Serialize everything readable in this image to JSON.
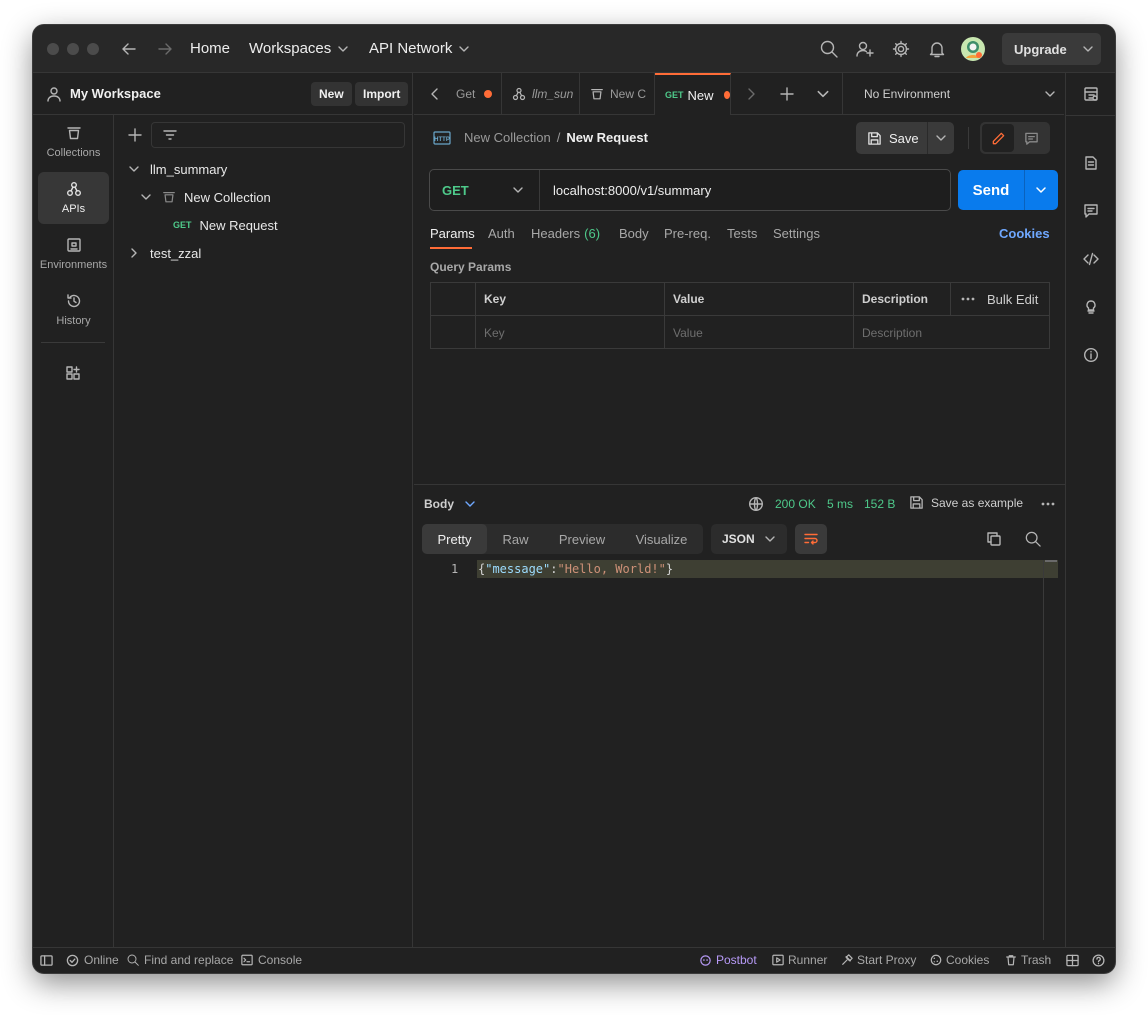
{
  "titlebar": {
    "home": "Home",
    "workspaces": "Workspaces",
    "api_network": "API Network",
    "upgrade": "Upgrade"
  },
  "workspace": {
    "name": "My Workspace",
    "new_label": "New",
    "import_label": "Import"
  },
  "rail": [
    {
      "label": "Collections",
      "icon": "collections-icon"
    },
    {
      "label": "APIs",
      "icon": "apis-icon",
      "active": true
    },
    {
      "label": "Environments",
      "icon": "environments-icon"
    },
    {
      "label": "History",
      "icon": "history-icon"
    }
  ],
  "tree": {
    "items": [
      {
        "label": "llm_summary"
      },
      {
        "label": "New Collection"
      },
      {
        "method": "GET",
        "label": "New Request"
      },
      {
        "label": "test_zzal"
      }
    ]
  },
  "tabs": [
    {
      "method": "",
      "label": "Get"
    },
    {
      "method": "",
      "label": "llm_sun"
    },
    {
      "method": "",
      "label": "New C"
    },
    {
      "method": "GET",
      "label": "New"
    }
  ],
  "environment": "No Environment",
  "breadcrumb": {
    "collection": "New Collection",
    "separator": "/",
    "request": "New Request"
  },
  "save_label": "Save",
  "request": {
    "method": "GET",
    "url": "localhost:8000/v1/summary",
    "send_label": "Send"
  },
  "request_tabs": {
    "params": "Params",
    "auth": "Auth",
    "headers": "Headers",
    "headers_count": "(6)",
    "body": "Body",
    "prereq": "Pre-req.",
    "tests": "Tests",
    "settings": "Settings",
    "cookies": "Cookies"
  },
  "query_params": {
    "title": "Query Params",
    "headers": {
      "key": "Key",
      "value": "Value",
      "description": "Description",
      "bulk_edit": "Bulk Edit"
    },
    "placeholders": {
      "key": "Key",
      "value": "Value",
      "description": "Description"
    }
  },
  "response": {
    "body_label": "Body",
    "status": "200 OK",
    "time": "5 ms",
    "size": "152 B",
    "save_example": "Save as example",
    "views": {
      "pretty": "Pretty",
      "raw": "Raw",
      "preview": "Preview",
      "visualize": "Visualize"
    },
    "format": "JSON",
    "line_number": "1",
    "code": {
      "open": "{",
      "key": "\"message\"",
      "colon": ":",
      "value": "\"Hello, World!\"",
      "close": "}"
    }
  },
  "statusbar": {
    "online": "Online",
    "find_replace": "Find and replace",
    "console": "Console",
    "postbot": "Postbot",
    "runner": "Runner",
    "proxy": "Start Proxy",
    "cookies": "Cookies",
    "trash": "Trash"
  },
  "colors": {
    "accent": "#ff6c37",
    "send_blue": "#097bed",
    "status_green": "#4ec98a",
    "cookies_blue": "#6fa8ff",
    "postbot_purple": "#b79af7"
  }
}
